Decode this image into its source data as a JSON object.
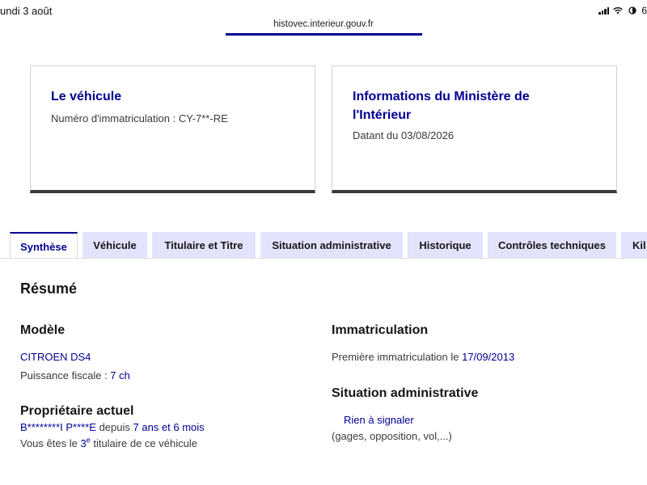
{
  "status_bar": {
    "date": "undi 3 août",
    "battery": "6"
  },
  "url_bar": {
    "url": "histovec.interieur.gouv.fr"
  },
  "vehicle_card": {
    "title": "Le véhicule",
    "plate_label": "Numéro d'immatriculation :",
    "plate_value": "CY-7**-RE"
  },
  "ministry_card": {
    "title_line1": "Informations du Ministère de",
    "title_line2": "l'Intérieur",
    "date_text": "Datant du 03/08/2026"
  },
  "tabs": [
    {
      "label": "Synthèse",
      "active": true
    },
    {
      "label": "Véhicule",
      "active": false
    },
    {
      "label": "Titulaire et Titre",
      "active": false
    },
    {
      "label": "Situation administrative",
      "active": false
    },
    {
      "label": "Historique",
      "active": false
    },
    {
      "label": "Contrôles techniques",
      "active": false
    },
    {
      "label": "Kil",
      "active": false
    }
  ],
  "summary": {
    "title": "Résumé",
    "model": {
      "heading": "Modèle",
      "name": "CITROEN DS4",
      "power_label": "Puissance fiscale :",
      "power_value": "7 ch"
    },
    "owner": {
      "heading": "Propriétaire actuel",
      "name": "B********I P****E",
      "since_label": "depuis",
      "duration": "7 ans et 6 mois",
      "rank_prefix": "Vous êtes le",
      "rank_number": "3",
      "rank_suffix": "e",
      "rank_text": "titulaire de ce véhicule"
    },
    "registration": {
      "heading": "Immatriculation",
      "first_label": "Première immatriculation le",
      "first_date": "17/09/2013"
    },
    "admin_status": {
      "heading": "Situation administrative",
      "value": "Rien à signaler",
      "details": "(gages, opposition, vol,...)"
    }
  },
  "colors": {
    "accent": "#000091",
    "tab_background": "#e3e3fd",
    "card_border_bottom": "#3a3a3a"
  }
}
